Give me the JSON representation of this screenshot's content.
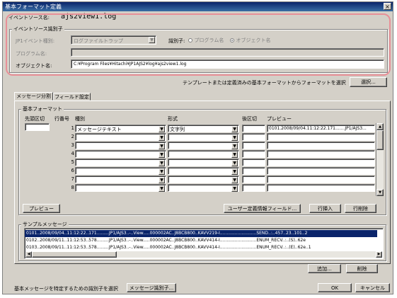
{
  "window": {
    "title": "基本フォーマット定義",
    "close": "×"
  },
  "event_source": {
    "label": "イベントソース名:",
    "value": "ajs2view1.log"
  },
  "identifier_group": {
    "title": "イベントソース識別子",
    "jp1_type_label": "JP1イベント種別:",
    "jp1_type_value": "ログファイルトラップ",
    "identifier_label": "識別子:",
    "radio_program": "プログラム名",
    "radio_object": "オブジェクト名",
    "program_label": "プログラム名:",
    "program_value": "",
    "object_label": "オブジェクト名:",
    "object_value": "C:¥Program Files¥Hitachi¥JP1AJS2¥log¥ajs2view1.log"
  },
  "template_hint": "テンプレートまたは定義済みの基本フォーマットからフォーマットを選択",
  "select_button": "選択...",
  "tabs": [
    "メッセージ分割",
    "フィールド設定"
  ],
  "basic_format": {
    "title": "基本フォーマット",
    "columns": [
      "先頭区切",
      "行番号",
      "種別",
      "形式",
      "後区切",
      "プレビュー"
    ],
    "rows": [
      {
        "num": "1",
        "type": "メッセージテキスト",
        "format": "文字列",
        "preview": "0101.2008/09/04.11:12:22.171.......JP1/AJS3..."
      },
      {
        "num": "2",
        "type": "",
        "format": "",
        "preview": ""
      },
      {
        "num": "3",
        "type": "",
        "format": "",
        "preview": ""
      },
      {
        "num": "4",
        "type": "",
        "format": "",
        "preview": ""
      },
      {
        "num": "5",
        "type": "",
        "format": "",
        "preview": ""
      },
      {
        "num": "6",
        "type": "",
        "format": "",
        "preview": ""
      },
      {
        "num": "7",
        "type": "",
        "format": "",
        "preview": ""
      },
      {
        "num": "8",
        "type": "",
        "format": "",
        "preview": ""
      }
    ],
    "preview_button": "プレビュー",
    "user_field_button": "ユーザー定義情報フィールド...",
    "insert_button": "行挿入",
    "delete_row_button": "行削除"
  },
  "sample": {
    "title": "サンプルメッセージ",
    "rows": [
      {
        "text": "0101..2008/09/04..11:12:22..171.........JP1/AJS3..-..View.....000002AC..J8BCB800..KAVV219-I...........................SEND..:..457..23..101..2",
        "selected": true
      },
      {
        "text": "0102..2008/09/11..11:12:53..578.........JP1/AJS3..-..View.....000002AC..J8BCB800..KAVV414-I...........................ENUM_RECV..:..(S)..62e",
        "selected": false
      },
      {
        "text": "0103..2008/09/11..11:12:53..578.........JP1/AJS3..-..View.....000002AC..J8BCB800..KAVV414-I...........................ENUM_RECV..:..(E)..62e..1",
        "selected": false
      }
    ],
    "add_button": "追加...",
    "delete_button": "削除"
  },
  "footer": {
    "identifier_hint": "基本メッセージを特定するための識別子を選択",
    "identifier_button": "メッセージ識別子...",
    "ok": "OK",
    "cancel": "キャンセル"
  },
  "colors": {
    "selection": "#0a246a",
    "highlight": "#e89098"
  }
}
